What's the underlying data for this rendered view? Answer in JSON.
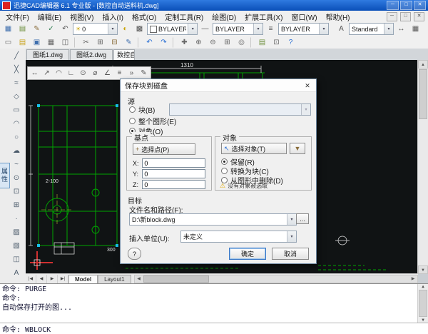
{
  "icons": {
    "dropdown": "▾"
  },
  "scrollbar": {
    "up": "▲",
    "down": "▼",
    "left": "◀",
    "right": "▶"
  },
  "window": {
    "title": "迅捷CAD编辑器 6.1 专业版 - [数控自动送料机.dwg]"
  },
  "window_controls": {
    "minimize": "─",
    "maximize": "□",
    "close": "✕"
  },
  "menu": {
    "items": [
      "文件(F)",
      "编辑(E)",
      "视图(V)",
      "插入(I)",
      "格式(O)",
      "定制工具(R)",
      "绘图(D)",
      "扩展工具(X)",
      "窗口(W)",
      "帮助(H)"
    ],
    "doc_controls": [
      "─",
      "□",
      "✕"
    ]
  },
  "toolbar_row1": {
    "icons_a": [
      {
        "name": "qselect-icon",
        "glyph": "▦",
        "color": "#3f6fae"
      },
      {
        "name": "layer-properties-icon",
        "glyph": "▤",
        "color": "#6d8f3c"
      },
      {
        "name": "layer-states-icon",
        "glyph": "✎",
        "color": "#8a6d3b"
      },
      {
        "name": "make-layer-current-icon",
        "glyph": "✓",
        "color": "#2f7d4f"
      },
      {
        "name": "layer-previous-icon",
        "glyph": "↶",
        "color": "#555555"
      }
    ],
    "layer_combo": {
      "bulb": "☀",
      "value": "0"
    },
    "icons_b": [
      {
        "name": "layer-off-icon",
        "glyph": "◐",
        "color": "#c8a200"
      },
      {
        "name": "layer-isolate-icon",
        "glyph": "▩",
        "color": "#555555"
      }
    ],
    "color_value": "BYLAYER",
    "linetype_icon": "—",
    "linetype_value": "BYLAYER",
    "lineweight_icon": "≡",
    "lineweight_value": "BYLAYER",
    "text_style_icon": "A",
    "style_value": "Standard",
    "icons_c": [
      {
        "name": "dim-style-icon",
        "glyph": "↔",
        "color": "#555555"
      },
      {
        "name": "table-style-icon",
        "glyph": "▦",
        "color": "#555555"
      }
    ]
  },
  "toolbar_row2": {
    "icons": [
      {
        "name": "new-file-icon",
        "glyph": "▭",
        "color": "#666666"
      },
      {
        "name": "open-file-icon",
        "glyph": "▤",
        "color": "#c8a21a"
      },
      {
        "name": "save-file-icon",
        "glyph": "▣",
        "color": "#3f6fae"
      },
      {
        "name": "plot-icon",
        "glyph": "▦",
        "color": "#666666"
      },
      {
        "name": "plot-preview-icon",
        "glyph": "◫",
        "color": "#666666"
      },
      {
        "sep": true
      },
      {
        "name": "cut-icon",
        "glyph": "✂",
        "color": "#666666"
      },
      {
        "name": "copy-icon",
        "glyph": "⊞",
        "color": "#666666"
      },
      {
        "name": "paste-icon",
        "glyph": "⊟",
        "color": "#8a6d3b"
      },
      {
        "name": "match-properties-icon",
        "glyph": "✎",
        "color": "#3f6fae"
      },
      {
        "sep": true
      },
      {
        "name": "undo-icon",
        "glyph": "↶",
        "color": "#2a6fd4"
      },
      {
        "name": "redo-icon",
        "glyph": "↷",
        "color": "#2a6fd4"
      },
      {
        "sep": true
      },
      {
        "name": "pan-icon",
        "glyph": "✚",
        "color": "#666666"
      },
      {
        "name": "zoom-in-icon",
        "glyph": "⊕",
        "color": "#666666"
      },
      {
        "name": "zoom-out-icon",
        "glyph": "⊖",
        "color": "#666666"
      },
      {
        "name": "zoom-window-icon",
        "glyph": "⊞",
        "color": "#666666"
      },
      {
        "name": "zoom-extents-icon",
        "glyph": "◎",
        "color": "#666666"
      },
      {
        "sep": true
      },
      {
        "name": "properties-palette-icon",
        "glyph": "▤",
        "color": "#6d8f3c"
      },
      {
        "name": "design-center-icon",
        "glyph": "⊡",
        "color": "#666666"
      },
      {
        "name": "help-icon",
        "glyph": "?",
        "color": "#2a6fd4"
      }
    ]
  },
  "left_toolbar": {
    "icons": [
      {
        "name": "line-icon",
        "glyph": "╱"
      },
      {
        "name": "construction-line-icon",
        "glyph": "╳"
      },
      {
        "name": "polyline-icon",
        "glyph": "≈"
      },
      {
        "name": "polygon-icon",
        "glyph": "◇"
      },
      {
        "name": "rectangle-icon",
        "glyph": "▭"
      },
      {
        "name": "arc-icon",
        "glyph": "◠"
      },
      {
        "name": "circle-icon",
        "glyph": "○"
      },
      {
        "name": "revcloud-icon",
        "glyph": "☁"
      },
      {
        "name": "spline-icon",
        "glyph": "~"
      },
      {
        "name": "ellipse-icon",
        "glyph": "⊙"
      },
      {
        "name": "insert-block-icon",
        "glyph": "⊡"
      },
      {
        "name": "make-block-icon",
        "glyph": "⊞"
      },
      {
        "name": "point-icon",
        "glyph": "·"
      },
      {
        "name": "hatch-icon",
        "glyph": "▨"
      },
      {
        "name": "gradient-icon",
        "glyph": "▧"
      },
      {
        "name": "region-icon",
        "glyph": "◫"
      },
      {
        "name": "mtext-icon",
        "glyph": "A"
      }
    ]
  },
  "dim_toolbar": {
    "icons": [
      {
        "name": "linear-dimension-icon",
        "glyph": "↔"
      },
      {
        "name": "aligned-dimension-icon",
        "glyph": "↗"
      },
      {
        "name": "arc-length-dimension-icon",
        "glyph": "◠"
      },
      {
        "name": "ordinate-dimension-icon",
        "glyph": "∟"
      },
      {
        "name": "radius-dimension-icon",
        "glyph": "⊙"
      },
      {
        "name": "diameter-dimension-icon",
        "glyph": "⌀"
      },
      {
        "name": "angular-dimension-icon",
        "glyph": "∠"
      },
      {
        "name": "quick-dimension-icon",
        "glyph": "≡"
      },
      {
        "name": "continue-dimension-icon",
        "glyph": "»"
      },
      {
        "name": "dimension-edit-icon",
        "glyph": "✎"
      }
    ]
  },
  "doc_tabs": [
    {
      "label": "图纸1.dwg",
      "name": "doc-tab-sheet1"
    },
    {
      "label": "图纸2.dwg",
      "name": "doc-tab-sheet2"
    },
    {
      "label": "数控自动送料机.dwg",
      "name": "doc-tab-current",
      "active": true,
      "clip": true
    }
  ],
  "canvas": {
    "dim_top": "1310",
    "dim_left": "2-100",
    "dim_bottom": "300"
  },
  "dialog": {
    "title": "保存块到磁盘",
    "close": "✕",
    "icons": {
      "pick": "+",
      "select": "↖",
      "filter": "▼",
      "warning": "⚠"
    },
    "source": {
      "label": "源",
      "block": "块(B)",
      "entire": "整个图形(E)",
      "objects": "对象(O)"
    },
    "basepoint": {
      "label": "基点",
      "pick": "选择点(P)",
      "x": "X:",
      "y": "Y:",
      "z": "Z:",
      "xv": "0",
      "yv": "0",
      "zv": "0"
    },
    "objects": {
      "label": "对象",
      "select": "选择对象(T)",
      "retain": "保留(R)",
      "convert": "转换为块(C)",
      "remove": "从图形中删除(D)",
      "warning": "没有对象被选取"
    },
    "target": {
      "label": "目标",
      "filename_label": "文件名和路径(F):",
      "path": "D:\\新block.dwg",
      "browse": "...",
      "units_label": "插入单位(U):",
      "units": "未定义"
    },
    "buttons": {
      "help": "?",
      "ok": "确定",
      "cancel": "取消"
    }
  },
  "model_bar": {
    "nav": [
      "|◀",
      "◀",
      "▶",
      "▶|"
    ],
    "tabs": [
      {
        "label": "Model",
        "active": true,
        "name": "model-tab"
      },
      {
        "label": "Layout1",
        "name": "layout1-tab"
      }
    ]
  },
  "command": {
    "history": [
      "命令: PURGE",
      "命令:",
      "自动保存打开的图..."
    ],
    "prompt": "命令: WBLOCK"
  }
}
